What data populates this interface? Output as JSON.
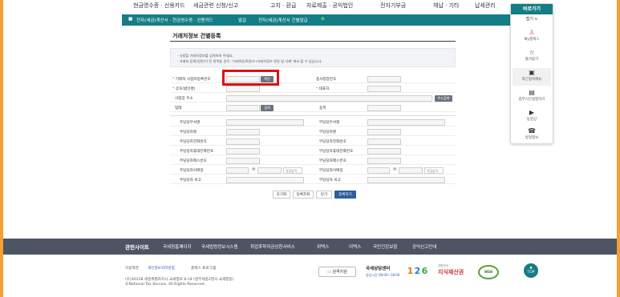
{
  "topmenu": [
    "현금영수증 · 신용카드",
    "세금관련 신청/신고",
    "고지 · 환급",
    "자료제출 · 공익법인",
    "전자기부금",
    "체납 · 기타",
    "납세관리"
  ],
  "nav": {
    "home_icon": "home-icon",
    "crumb1": "전자(세금)계산서 · 현금영수증 · 신용카드",
    "crumb2": "발급",
    "crumb3": "전자(세금)계산서 건별발급"
  },
  "quick": {
    "title": "바로가기",
    "close": "접기 ∨",
    "items": [
      {
        "icon": "user-icon",
        "label": "My홈택스"
      },
      {
        "icon": "star-icon",
        "label": "즐겨찾기"
      },
      {
        "icon": "recent-menu-icon",
        "label": "최근접속메뉴"
      },
      {
        "icon": "building-icon",
        "label": "업무시간설정하기"
      },
      {
        "icon": "video-icon",
        "label": "동영상"
      },
      {
        "icon": "headset-icon",
        "label": "방정정보"
      }
    ]
  },
  "page": {
    "title": "거래처정보 건별등록",
    "notice": [
      "· 사용할 거래처정보를 입력하여 주세요.",
      "· 거래처 등록(일반)이 된 항목을 경우, '거래처등록관리→거래처정보 변경 및 삭제' 에서 할 수 있습니다."
    ]
  },
  "form": {
    "biz_no_label": "거래처 사업자등록번호",
    "biz_no_btn": "확인",
    "sub_biz_label": "종사업장번호",
    "company_label": "상호(법인명)",
    "ceo_label": "대표자",
    "address_label": "사업장 주소",
    "address_btn": "주소검색",
    "type_label": "업태",
    "type_btn": "검색",
    "item_label": "종목",
    "dept_label": "주담당부서명",
    "dept2_label": "부담당부서명",
    "person_label": "주담당자명",
    "person2_label": "부담당자명",
    "phone_label": "주담당자전화번호",
    "phone2_label": "부담당자전화번호",
    "mobile_label": "주담당자휴대전화번호",
    "mobile2_label": "부담당자휴대전화번호",
    "fax_label": "주담당자팩스번호",
    "fax2_label": "부담당자팩스번호",
    "email_label": "주담당자이메일",
    "email2_label": "부담당자이메일",
    "email_at": "@",
    "email_select": "직접입력",
    "note_label": "주담당자 비고",
    "note2_label": "부담당자 비고"
  },
  "actions": {
    "reset": "초기화",
    "list": "등록조회",
    "close": "닫기",
    "register": "등록하기"
  },
  "footer": {
    "related": "관련사이트",
    "links": [
      "국세청홈페이지",
      "국세법령정보시스템",
      "취업후학자금상환서비스",
      "위택스",
      "이택스",
      "국민건강보험",
      "공익신고안내"
    ],
    "terms": "이용약관",
    "privacy": "개인정보처리방침",
    "guide": "홈택스 프로그램",
    "address": "(우)30128 세종특별자치시 국세청로 8-14 (정부세종2청사 국세청동)",
    "copyright": "©National Tax Service. All Rights Reserved.",
    "remote_btn": "원격지원",
    "center_title": "국세상담센터",
    "center_hours": "상담시간 09:00~18:00",
    "center_number": "126",
    "logo1_small": "대한민국",
    "logo1": "지식재산권",
    "logo2": "WEB",
    "top_btn": "TOP"
  },
  "colors": {
    "teal": "#157d86",
    "highlight": "#e01010",
    "footer_bar": "#4d5564",
    "outer_border": "#f5a030"
  }
}
